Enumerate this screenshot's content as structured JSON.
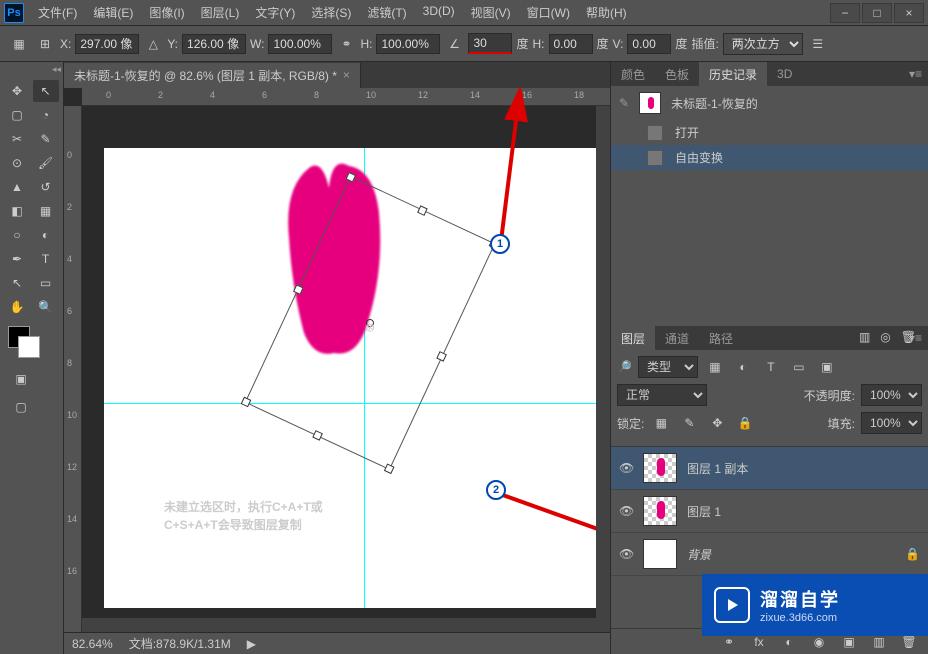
{
  "menu": [
    "文件(F)",
    "编辑(E)",
    "图像(I)",
    "图层(L)",
    "文字(Y)",
    "选择(S)",
    "滤镜(T)",
    "3D(D)",
    "视图(V)",
    "窗口(W)",
    "帮助(H)"
  ],
  "options": {
    "x_label": "X:",
    "x_value": "297.00 像",
    "y_label": "Y:",
    "y_value": "126.00 像",
    "w_label": "W:",
    "w_value": "100.00%",
    "h_label": "H:",
    "h_value": "100.00%",
    "angle_value": "30",
    "angle_unit": "度",
    "h2_label": "H:",
    "h2_value": "0.00",
    "h2_unit": "度",
    "v_label": "V:",
    "v_value": "0.00",
    "v_unit": "度",
    "interp_label": "插值:",
    "interp_value": "两次立方"
  },
  "tab": {
    "title": "未标题-1-恢复的 @ 82.6% (图层 1 副本, RGB/8) *"
  },
  "ruler_h": [
    "0",
    "2",
    "4",
    "6",
    "8",
    "10",
    "12",
    "14",
    "16",
    "18"
  ],
  "ruler_v": [
    "0",
    "2",
    "4",
    "6",
    "8",
    "10",
    "12",
    "14",
    "16"
  ],
  "annotation": {
    "line1": "未建立选区时，执行C+A+T或",
    "line2": "C+S+A+T会导致图层复制",
    "marker1": "1",
    "marker2": "2"
  },
  "status": {
    "zoom": "82.64%",
    "doc": "文档:878.9K/1.31M"
  },
  "color_panel_tabs": [
    "颜色",
    "色板",
    "历史记录",
    "3D"
  ],
  "history": {
    "title": "未标题-1-恢复的",
    "items": [
      {
        "label": "打开",
        "active": false
      },
      {
        "label": "自由变换",
        "active": true
      }
    ]
  },
  "layers_panel_tabs": [
    "图层",
    "通道",
    "路径"
  ],
  "layers_opts": {
    "kind": "类型",
    "blend": "正常",
    "opacity_label": "不透明度:",
    "opacity_value": "100%",
    "lock_label": "锁定:",
    "fill_label": "填充:",
    "fill_value": "100%"
  },
  "layers": [
    {
      "name": "图层 1 副本",
      "active": true,
      "transparent": true,
      "locked": false
    },
    {
      "name": "图层 1",
      "active": false,
      "transparent": true,
      "locked": false
    },
    {
      "name": "背景",
      "active": false,
      "transparent": false,
      "locked": true
    }
  ],
  "watermark": {
    "title": "溜溜自学",
    "url": "zixue.3d66.com"
  }
}
